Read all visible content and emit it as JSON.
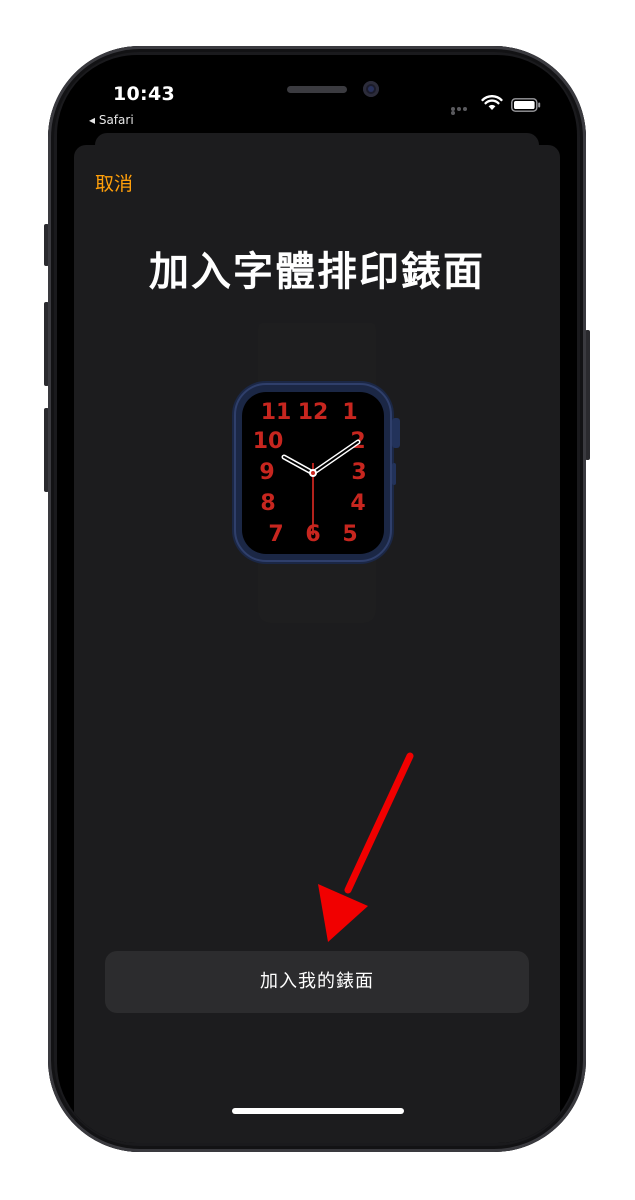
{
  "status_bar": {
    "time": "10:43",
    "back_app": "◂ Safari"
  },
  "sheet": {
    "cancel_label": "取消",
    "title": "加入字體排印錶面",
    "primary_button_label": "加入我的錶面"
  },
  "watch_face": {
    "numerals": [
      "12",
      "1",
      "2",
      "3",
      "4",
      "5",
      "6",
      "7",
      "8",
      "9",
      "10",
      "11"
    ],
    "numeral_color": "#c7261f",
    "case_color": "#1b2745",
    "band_color": "#1e1e1f"
  },
  "colors": {
    "accent": "#ff9f0a",
    "sheet_background": "#1c1c1e",
    "button_background": "#2c2c2e",
    "annotation_arrow": "#f10000"
  },
  "icons": [
    "wifi-icon",
    "battery-icon",
    "signal-dots-icon",
    "back-chevron-icon",
    "annotation-arrow-icon"
  ]
}
